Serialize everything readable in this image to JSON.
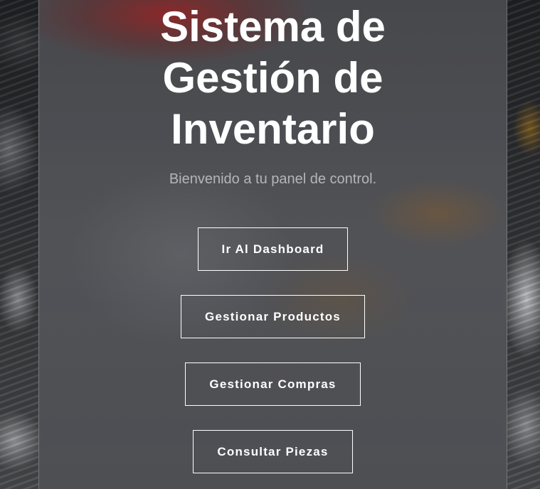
{
  "header": {
    "title": "Sistema de Gestión de Inventario",
    "subtitle": "Bienvenido a tu panel de control."
  },
  "actions": [
    {
      "label": "Ir Al Dashboard"
    },
    {
      "label": "Gestionar Productos"
    },
    {
      "label": "Gestionar Compras"
    },
    {
      "label": "Consultar Piezas"
    }
  ]
}
